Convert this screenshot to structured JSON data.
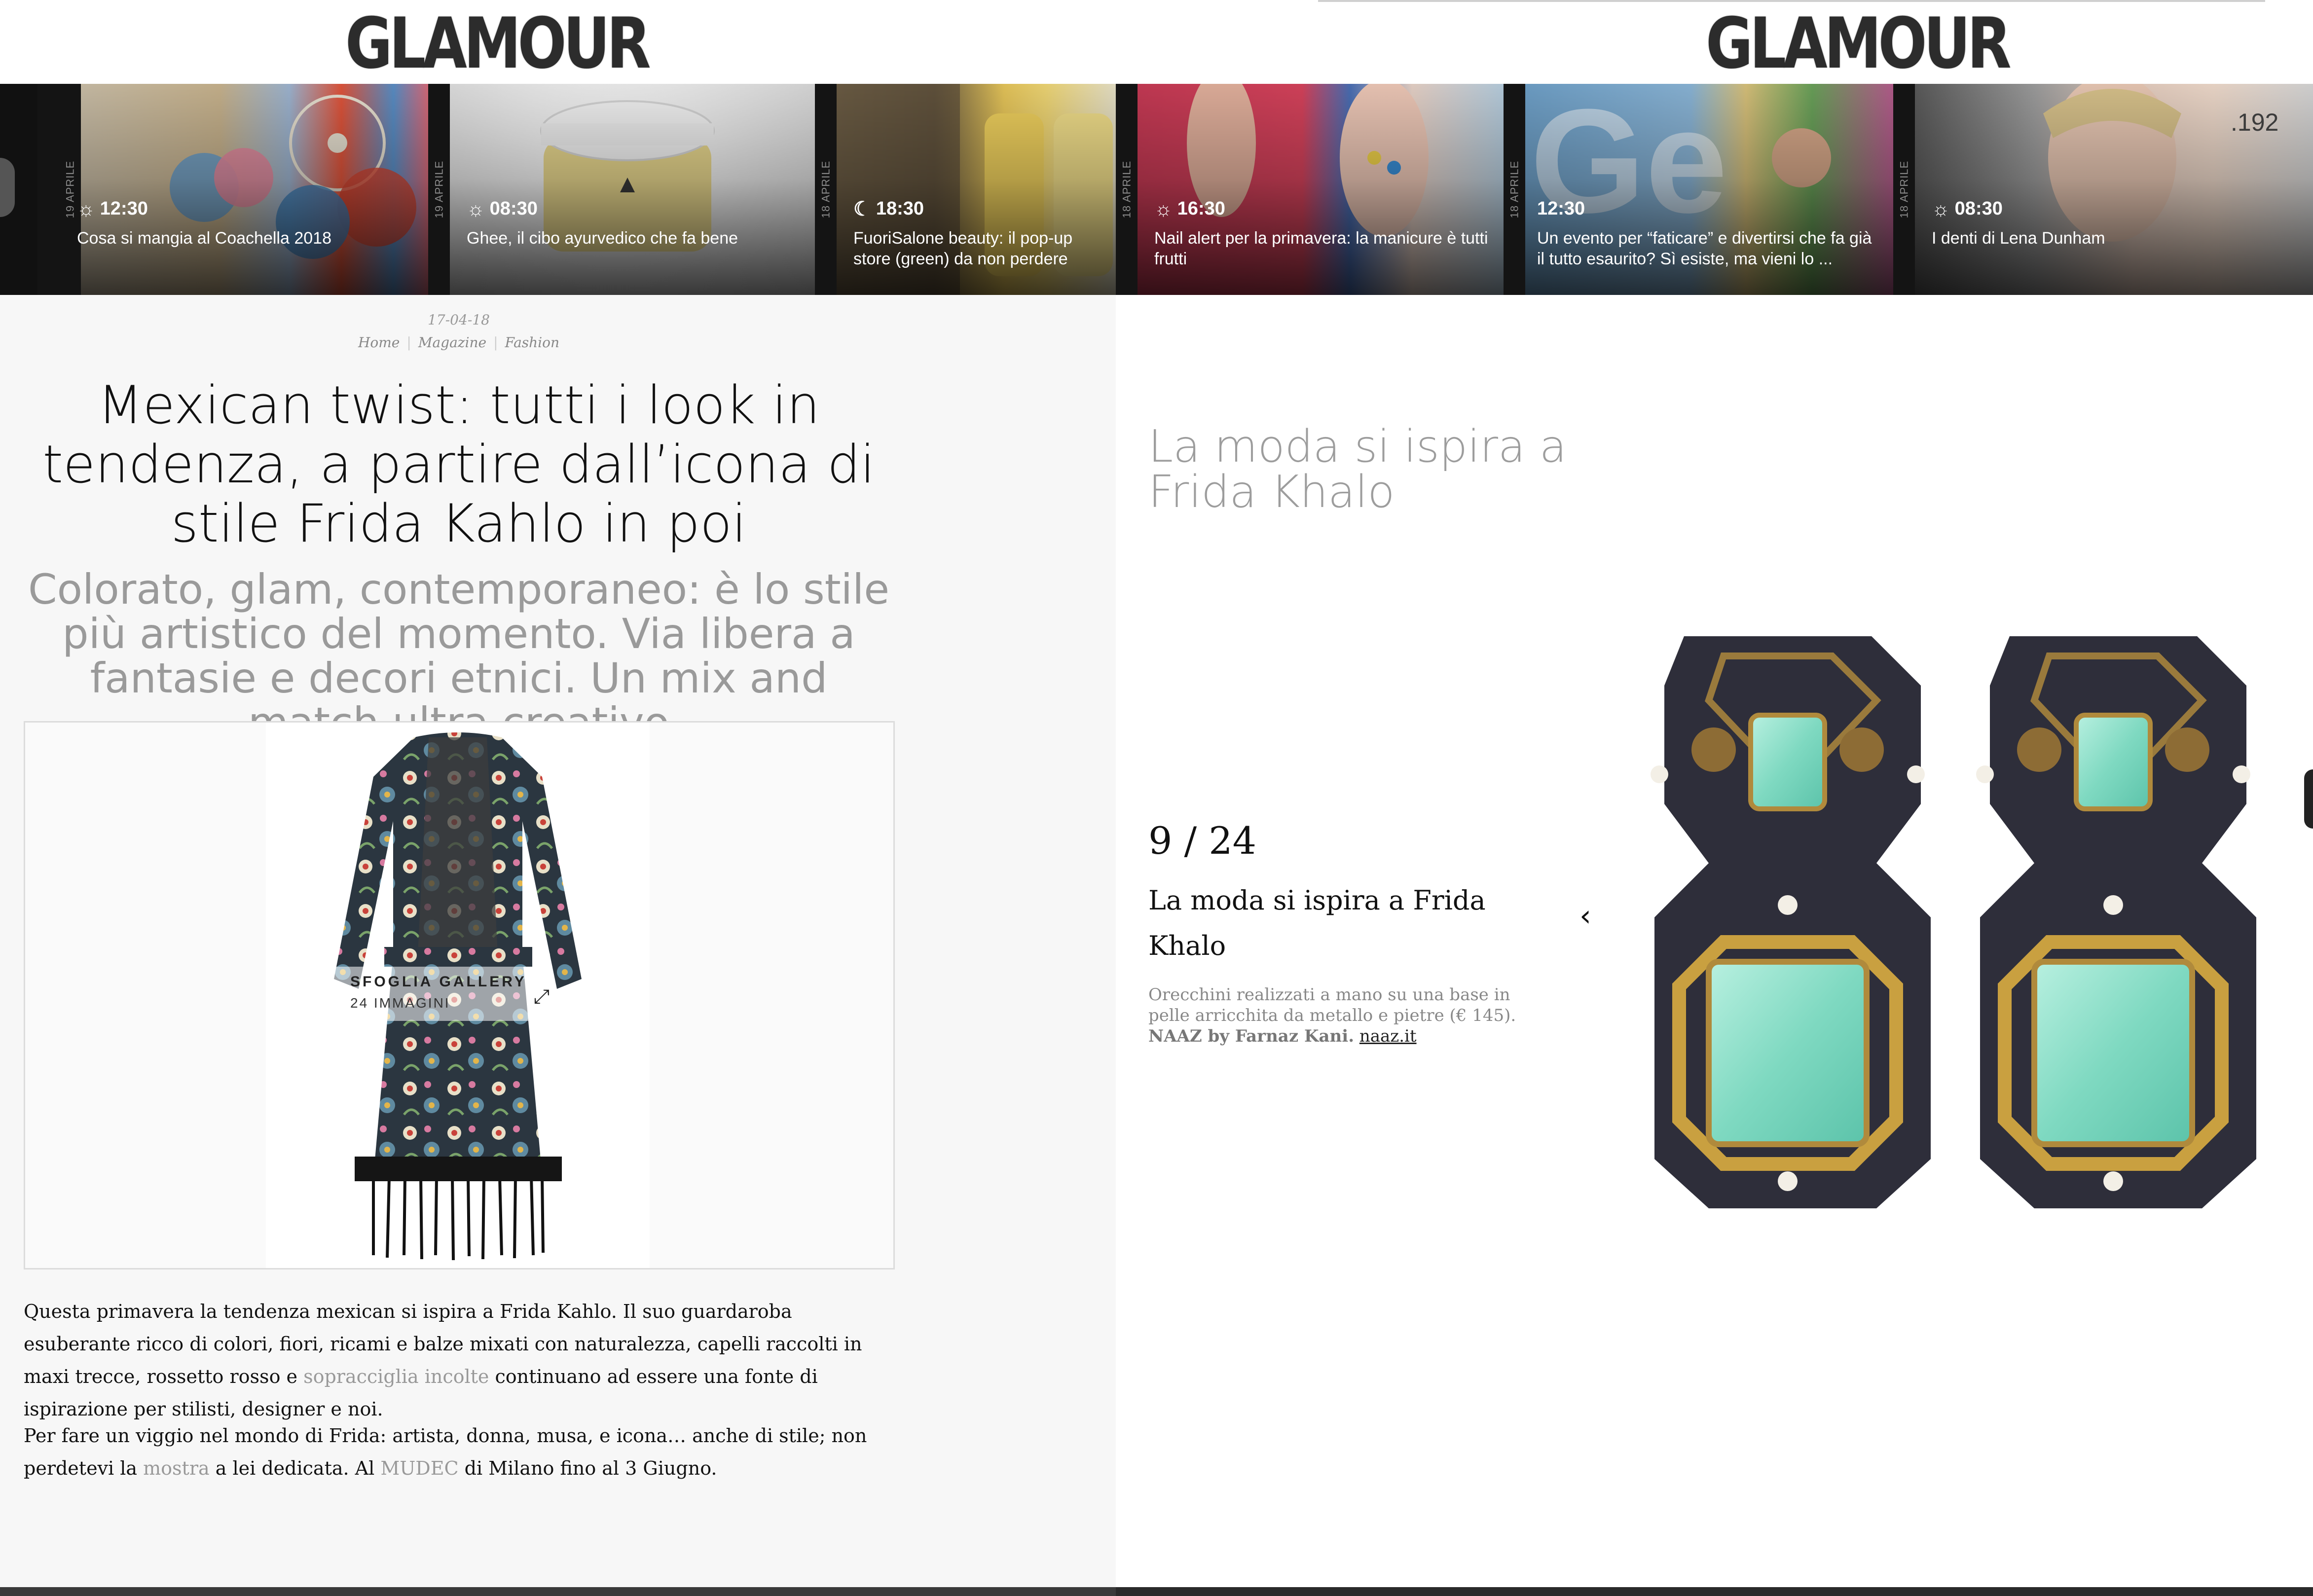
{
  "brand": {
    "logo": "GLAMOUR"
  },
  "strip_left": [
    {
      "date": "19 APRILE",
      "time": "12:30",
      "time_icon": "sun-icon",
      "title": "Cosa si mangia al Coachella 2018"
    },
    {
      "date": "19 APRILE",
      "time": "08:30",
      "time_icon": "sun-icon",
      "title": "Ghee, il cibo ayurvedico che fa bene"
    },
    {
      "date": "18 APRILE",
      "time": "18:30",
      "time_icon": "moon-icon",
      "title": "FuoriSalone beauty: il pop-up store (green) da non perdere"
    }
  ],
  "strip_right": [
    {
      "date": "18 APRILE",
      "time": "16:30",
      "time_icon": "sun-icon",
      "title": "Nail alert per la primavera: la manicure è tutti frutti"
    },
    {
      "date": "18 APRILE",
      "time": "12:30",
      "time_icon": "",
      "title": "Un evento per “faticare” e divertirsi che fa già il tutto esaurito? Sì esiste, ma vieni lo ..."
    },
    {
      "date": "18 APRILE",
      "time": "08:30",
      "time_icon": "sun-icon",
      "title": "I denti di Lena Dunham"
    }
  ],
  "article": {
    "date": "17-04-18",
    "breadcrumb": [
      "Home",
      "Magazine",
      "Fashion"
    ],
    "headline": "Mexican twist: tutti i look in tendenza, a partire dall’icona di stile Frida Kahlo in poi",
    "subtitle": "Colorato, glam, contemporaneo: è lo stile più artistico del momento. Via libera a fantasie e decori etnici. Un mix and match ultra creativo",
    "gallery_label": "SFOGLIA GALLERY",
    "gallery_count": "24 IMMAGINI",
    "p1_a": "Questa primavera la tendenza mexican si ispira a Frida Kahlo. Il suo guardaroba esuberante ricco di colori, fiori, ricami e balze mixati con naturalezza, capelli raccolti in maxi trecce, rossetto rosso e ",
    "p1_link": "sopracciglia incolte",
    "p1_b": " continuano ad essere una fonte di ispirazione per stilisti, designer e noi.",
    "p2_a": "Per fare un viggio nel mondo di Frida: artista, donna, musa, e icona… anche di stile; non perdetevi la ",
    "p2_link1": "mostra",
    "p2_b": " a lei dedicata. Al ",
    "p2_link2": "MUDEC",
    "p2_c": " di Milano fino al 3 Giugno."
  },
  "gallery": {
    "heading": "La moda si ispira a Frida Khalo",
    "counter": "9 / 24",
    "slide_title": "La moda si ispira a Frida Khalo",
    "desc_a": "Orecchini realizzati  a mano su una base in pelle arricchita da metallo e pietre (€ 145).",
    "desc_brand": "NAAZ by Farnaz Kani.",
    "desc_link": "naaz.it",
    "prev_icon": "chevron-left-icon"
  },
  "colors": {
    "accent_gem": "#7fd9c1",
    "leather": "#2e2e3a",
    "gold": "#b08a3c"
  }
}
